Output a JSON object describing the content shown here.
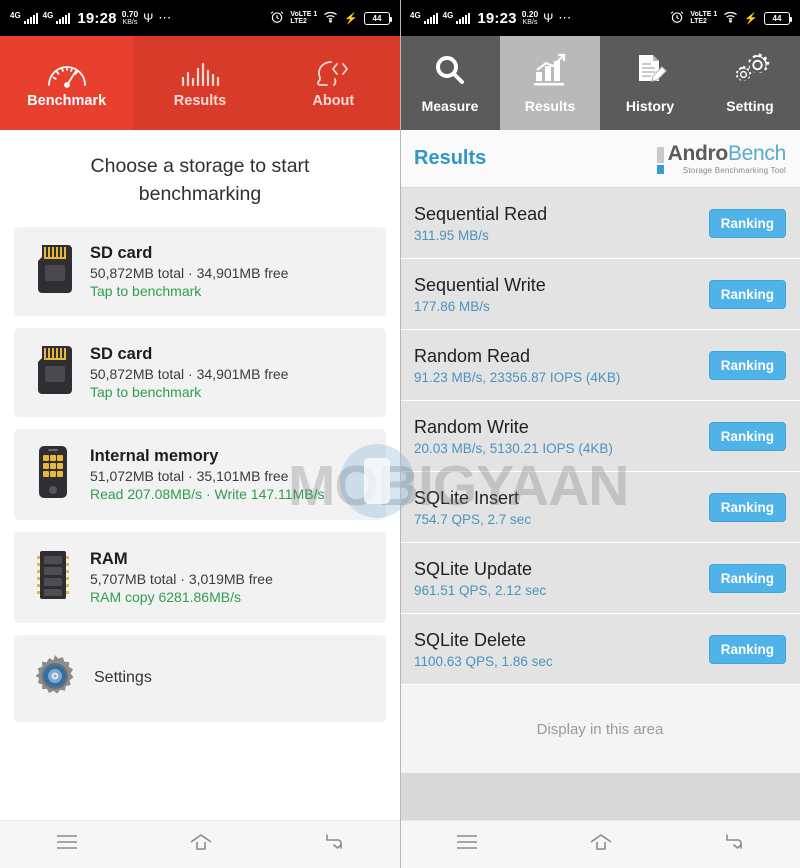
{
  "left_phone": {
    "status_bar": {
      "network1": "4G",
      "network2": "4G",
      "time": "19:28",
      "net_speed_value": "0.70",
      "net_speed_unit": "KB/s",
      "usb_icon": "usb-icon",
      "more_icon": "more-dots-icon",
      "alarm_icon": "alarm-clock-icon",
      "volte_line1": "VoLTE 1",
      "volte_line2": "LTE2",
      "wifi_icon": "wifi-icon",
      "charging_icon": "charging-bolt-icon",
      "battery": "44"
    },
    "tabs": [
      {
        "label": "Benchmark",
        "icon": "speedometer-icon",
        "active": true
      },
      {
        "label": "Results",
        "icon": "bar-chart-icon",
        "active": false
      },
      {
        "label": "About",
        "icon": "head-code-icon",
        "active": false
      }
    ],
    "headline": "Choose a storage to start benchmarking",
    "storage_cards": [
      {
        "name": "SD card",
        "capacity": "50,872MB total · 34,901MB free",
        "status": "Tap to benchmark",
        "icon": "sd-card-icon"
      },
      {
        "name": "SD card",
        "capacity": "50,872MB total · 34,901MB free",
        "status": "Tap to benchmark",
        "icon": "sd-card-icon"
      },
      {
        "name": "Internal memory",
        "capacity": "51,072MB total · 35,101MB free",
        "status": "Read 207.08MB/s · Write 147.11MB/s",
        "icon": "phone-internal-storage-icon"
      },
      {
        "name": "RAM",
        "capacity": "5,707MB total · 3,019MB free",
        "status": "RAM copy 6281.86MB/s",
        "icon": "ram-chip-icon"
      }
    ],
    "settings": {
      "label": "Settings",
      "icon": "gear-icon"
    },
    "nav_bar": {
      "menu": "menu-icon",
      "home": "home-icon",
      "back": "back-icon"
    }
  },
  "right_phone": {
    "status_bar": {
      "network1": "4G",
      "network2": "4G",
      "time": "19:23",
      "net_speed_value": "0.20",
      "net_speed_unit": "KB/s",
      "usb_icon": "usb-icon",
      "more_icon": "more-dots-icon",
      "alarm_icon": "alarm-clock-icon",
      "volte_line1": "VoLTE 1",
      "volte_line2": "LTE2",
      "wifi_icon": "wifi-icon",
      "charging_icon": "charging-bolt-icon",
      "battery": "44"
    },
    "tabs": [
      {
        "label": "Measure",
        "icon": "magnifier-icon",
        "active": false
      },
      {
        "label": "Results",
        "icon": "bar-chart-growth-icon",
        "active": true
      },
      {
        "label": "History",
        "icon": "document-pencil-icon",
        "active": false
      },
      {
        "label": "Setting",
        "icon": "gears-icon",
        "active": false
      }
    ],
    "header": {
      "title": "Results",
      "logo_primary": "Andro",
      "logo_secondary": "Bench",
      "logo_tagline": "Storage Benchmarking Tool"
    },
    "results": [
      {
        "name": "Sequential Read",
        "value": "311.95 MB/s",
        "button": "Ranking"
      },
      {
        "name": "Sequential Write",
        "value": "177.86 MB/s",
        "button": "Ranking"
      },
      {
        "name": "Random Read",
        "value": "91.23 MB/s, 23356.87 IOPS (4KB)",
        "button": "Ranking"
      },
      {
        "name": "Random Write",
        "value": "20.03 MB/s, 5130.21 IOPS (4KB)",
        "button": "Ranking"
      },
      {
        "name": "SQLite Insert",
        "value": "754.7 QPS, 2.7 sec",
        "button": "Ranking"
      },
      {
        "name": "SQLite Update",
        "value": "961.51 QPS, 2.12 sec",
        "button": "Ranking"
      },
      {
        "name": "SQLite Delete",
        "value": "1100.63 QPS, 1.86 sec",
        "button": "Ranking"
      }
    ],
    "ad_placeholder": "Display in this area",
    "nav_bar": {
      "menu": "menu-icon",
      "home": "home-icon",
      "back": "back-icon"
    }
  },
  "watermark": {
    "text": "MOBIGYAAN",
    "logo": "phone-circle-logo"
  },
  "colors": {
    "brand_red": "#d93b2b",
    "brand_red_active": "#e8402e",
    "tab_gray": "#5b5b5b",
    "tab_gray_active": "#b9b9b9",
    "accent_blue": "#3196c8",
    "ranking_blue": "#4fb3e8",
    "value_blue": "#4a93bd",
    "green_status": "#2e9e4f",
    "card_bg": "#f2f2f2",
    "row_bg": "#e3e3e3"
  }
}
